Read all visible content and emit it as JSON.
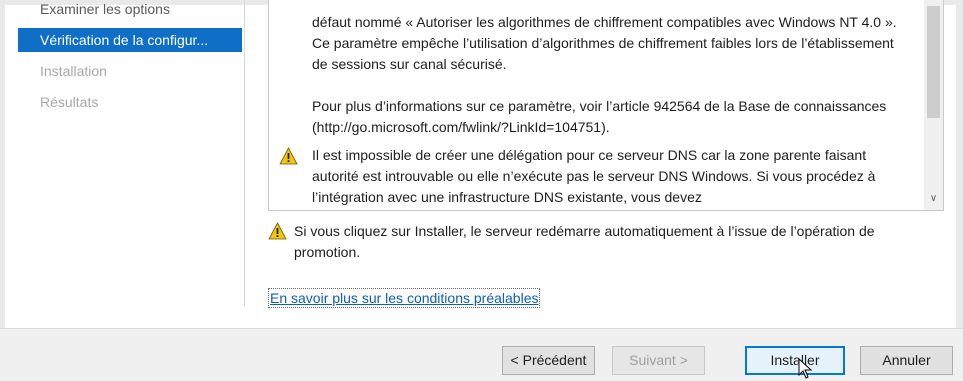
{
  "sidebar": {
    "items": [
      {
        "label": "Examiner les options",
        "state": "past"
      },
      {
        "label": "Vérification de la configur...",
        "state": "selected"
      },
      {
        "label": "Installation",
        "state": "disabled"
      },
      {
        "label": "Résultats",
        "state": "disabled"
      }
    ]
  },
  "results": {
    "messages": [
      {
        "icon": "warning-icon",
        "text": "défaut nommé « Autoriser les algorithmes de chiffrement compatibles avec Windows NT 4.0 ». Ce paramètre empêche l’utilisation d’algorithmes de chiffrement faibles lors de l’établissement de sessions sur canal sécurisé."
      },
      {
        "icon": "none",
        "text": "Pour plus d’informations sur ce paramètre, voir l’article 942564 de la Base de connaissances (http://go.microsoft.com/fwlink/?LinkId=104751)."
      },
      {
        "icon": "warning-icon",
        "text": "Il est impossible de créer une délégation pour ce serveur DNS car la zone parente faisant autorité est introuvable ou elle n’exécute pas le serveur DNS Windows. Si vous procédez à l’intégration avec une infrastructure DNS existante, vous devez"
      }
    ]
  },
  "warning_note": "Si vous cliquez sur Installer, le serveur redémarre automatiquement à l’issue de l’opération de promotion.",
  "prereq_link": "En savoir plus sur les conditions préalables",
  "buttons": {
    "previous": "< Précédent",
    "next": "Suivant >",
    "install": "Installer",
    "cancel": "Annuler"
  },
  "colors": {
    "selection": "#0f6fc6",
    "link": "#0e5fb3",
    "warning": "#f2c511"
  }
}
